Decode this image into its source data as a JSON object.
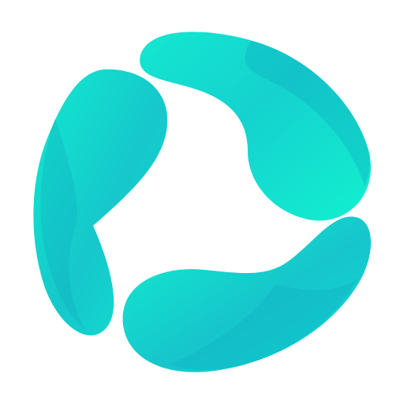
{
  "logo": {
    "icon": "three-petal-ring-logo",
    "colors": {
      "light": "#12F0CF",
      "mid": "#13D6CF",
      "dark": "#17B8C7",
      "shadow": "#0FA9BE",
      "background": "#FFFFFF"
    }
  }
}
